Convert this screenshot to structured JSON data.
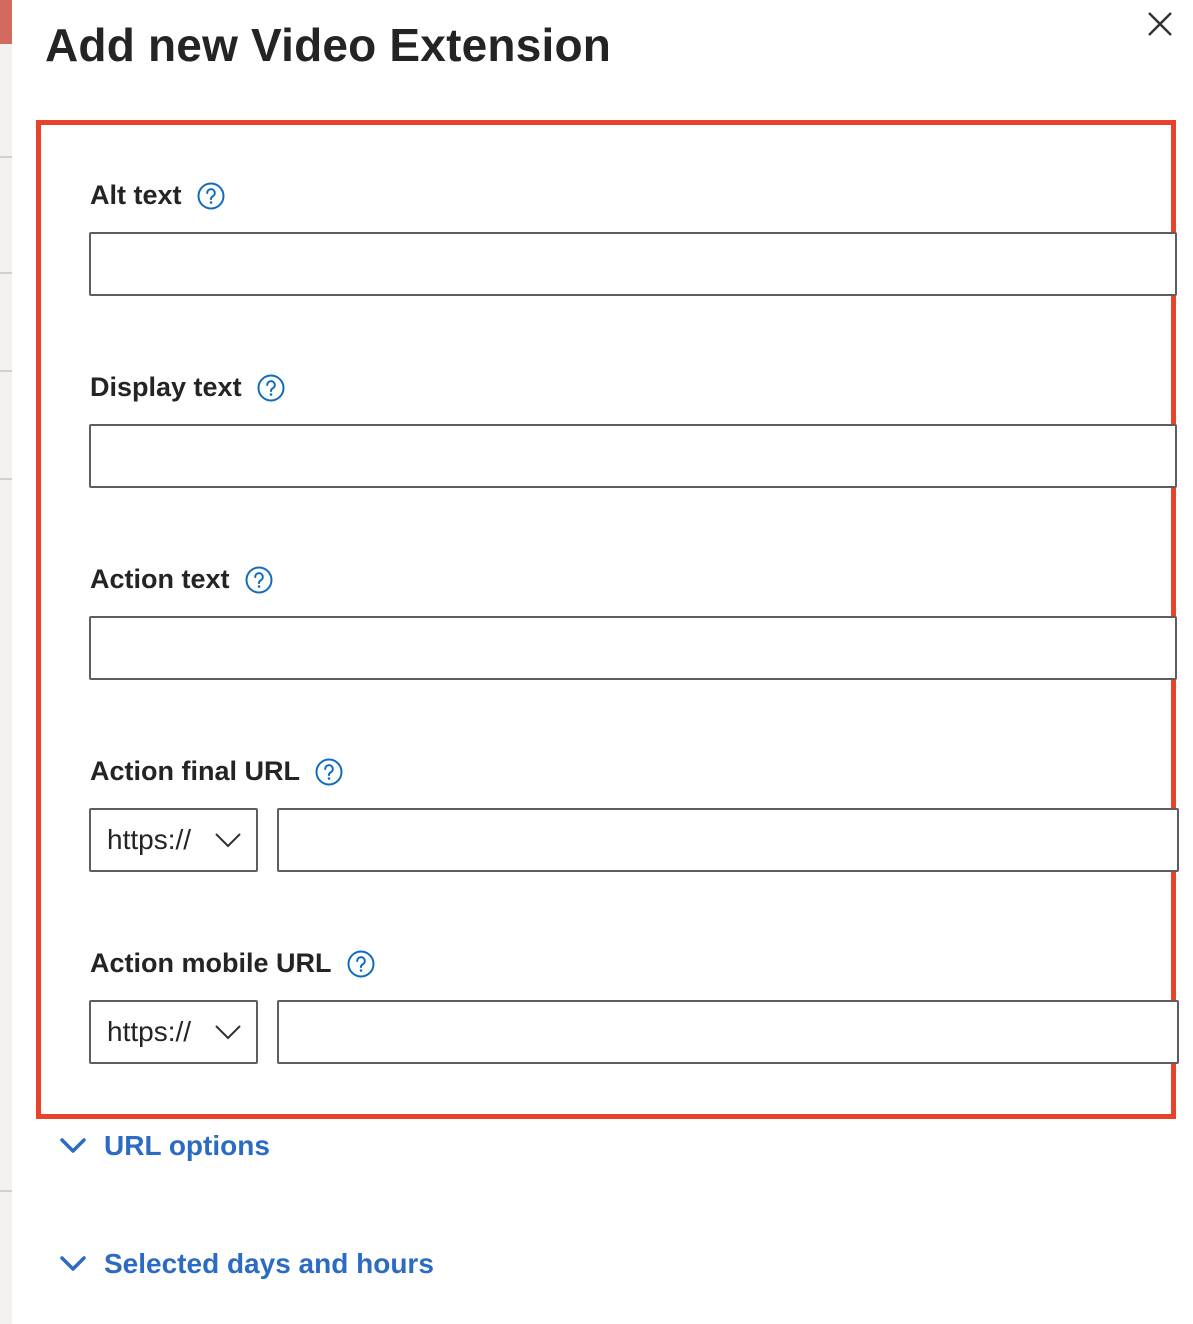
{
  "panel": {
    "title": "Add new Video Extension",
    "close_icon": "close-icon"
  },
  "fields": {
    "alt_text": {
      "label": "Alt text",
      "value": ""
    },
    "display_text": {
      "label": "Display text",
      "value": ""
    },
    "action_text": {
      "label": "Action text",
      "value": ""
    },
    "action_final_url": {
      "label": "Action final URL",
      "protocol": "https://",
      "value": ""
    },
    "action_mobile_url": {
      "label": "Action mobile URL",
      "protocol": "https://",
      "value": ""
    }
  },
  "expanders": {
    "url_options": "URL options",
    "selected_days": "Selected days and hours"
  },
  "colors": {
    "highlight_border": "#e8412c",
    "link_blue": "#2b6bc4",
    "help_icon_blue": "#0f6cbd"
  }
}
